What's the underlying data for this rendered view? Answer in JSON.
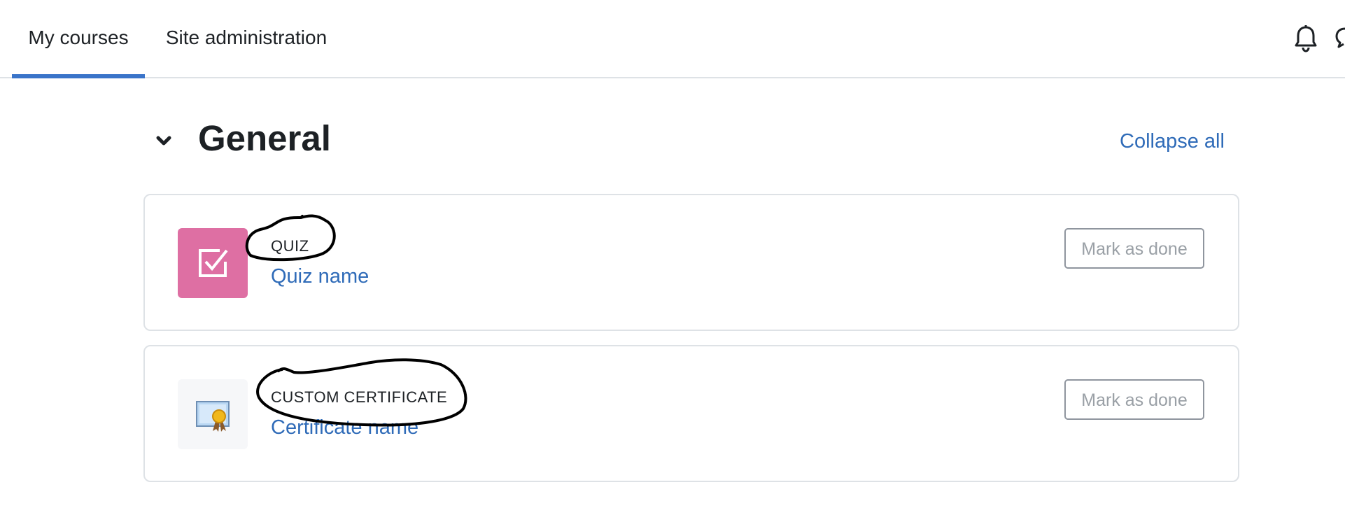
{
  "navbar": {
    "tabs": [
      {
        "label": "My courses",
        "active": true
      },
      {
        "label": "Site administration",
        "active": false
      }
    ],
    "icons": [
      "bell-icon",
      "chat-icon"
    ]
  },
  "section": {
    "title": "General",
    "collapse_label": "Collapse all"
  },
  "activities": [
    {
      "type": "QUIZ",
      "name": "Quiz name",
      "icon": "quiz-checkbox-icon",
      "icon_bg": "#de6fa3",
      "button_label": "Mark as done"
    },
    {
      "type": "CUSTOM CERTIFICATE",
      "name": "Certificate name",
      "icon": "certificate-icon",
      "icon_bg": "#f6f7f9",
      "button_label": "Mark as done"
    }
  ],
  "colors": {
    "accent": "#3a74c9",
    "link": "#2f6bb8",
    "text": "#1d2125",
    "border": "#dee2e6"
  }
}
